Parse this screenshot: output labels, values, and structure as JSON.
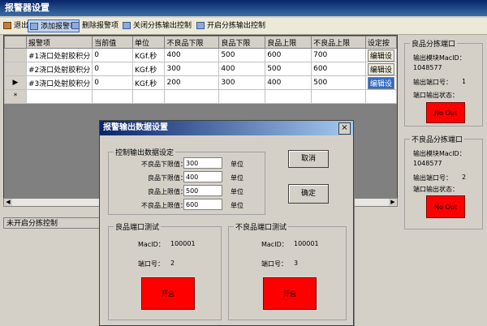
{
  "window": {
    "title": "报警器设置"
  },
  "toolbar": {
    "items": [
      {
        "label": "退出",
        "icon": "door-exit-icon"
      },
      {
        "label": "添加报警项",
        "icon": "add-icon"
      },
      {
        "label": "删除报警项",
        "icon": "delete-icon"
      },
      {
        "label": "关闭分拣输出控制",
        "icon": "monitor-icon"
      },
      {
        "label": "开启分拣输出控制",
        "icon": "monitor-icon"
      }
    ]
  },
  "grid": {
    "columns": [
      "报警项",
      "当前值",
      "单位",
      "不良品下限",
      "良品下限",
      "良品上限",
      "不良品上限",
      "设定按"
    ],
    "rows": [
      {
        "cells": [
          "#1浇口处射胶积分",
          "0",
          "KGf.秒",
          "400",
          "500",
          "600",
          "700",
          "编辑设"
        ]
      },
      {
        "cells": [
          "#2浇口处射胶积分",
          "0",
          "KGf.秒",
          "300",
          "400",
          "500",
          "600",
          "编辑设"
        ]
      },
      {
        "cells": [
          "#3浇口处射胶积分",
          "0",
          "KGf.秒",
          "200",
          "300",
          "400",
          "500",
          "编辑设"
        ]
      }
    ],
    "new_row_marker": "*",
    "current_row_marker": "▶"
  },
  "statusbar": {
    "text": "未开启分拣控制"
  },
  "good_port": {
    "title": "良品分拣端口",
    "module_id_label": "输出模块MacID：",
    "module_id": "1048577",
    "port_label": "输出端口号：",
    "port": "1",
    "state_label": "端口输出状态：",
    "state_button": "No Out"
  },
  "bad_port": {
    "title": "不良品分拣端口",
    "module_id_label": "输出模块MacID：",
    "module_id": "1048577",
    "port_label": "输出端口号：",
    "port": "2",
    "state_label": "端口输出状态：",
    "state_button": "No Out"
  },
  "dialog": {
    "title": "报警输出数据设置",
    "close": "×",
    "group_title": "控制输出数据设定",
    "fields": [
      {
        "label": "不良品下限值：",
        "value": "300",
        "unit": "单位"
      },
      {
        "label": "良品下限值：",
        "value": "400",
        "unit": "单位"
      },
      {
        "label": "良品上限值：",
        "value": "500",
        "unit": "单位"
      },
      {
        "label": "不良品上限值：",
        "value": "600",
        "unit": "单位"
      }
    ],
    "cancel": "取消",
    "ok": "确定",
    "good_test": {
      "title": "良品端口测试",
      "macid_label": "MacID：",
      "macid": "100001",
      "port_label": "端口号：",
      "port": "2",
      "button": "开启"
    },
    "bad_test": {
      "title": "不良品端口测试",
      "macid_label": "MacID：",
      "macid": "100001",
      "port_label": "端口号：",
      "port": "3",
      "button": "开启"
    }
  }
}
